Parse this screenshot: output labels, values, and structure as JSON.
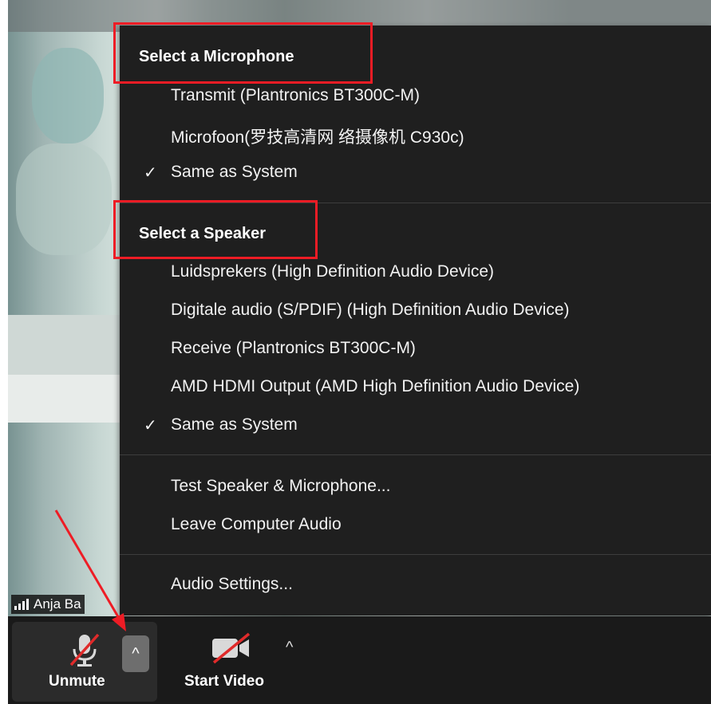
{
  "participant": {
    "name": "Anja Ba",
    "signal_icon": "signal-bars-icon"
  },
  "menu": {
    "microphone_heading": "Select a Microphone",
    "microphones": [
      {
        "label": "Transmit (Plantronics BT300C-M)",
        "checked": false
      },
      {
        "label": "Microfoon(罗技高清网 络摄像机 C930c)",
        "checked": false
      },
      {
        "label": "Same as System",
        "checked": true
      }
    ],
    "speaker_heading": "Select a Speaker",
    "speakers": [
      {
        "label": "Luidsprekers (High Definition Audio Device)",
        "checked": false
      },
      {
        "label": "Digitale audio (S/PDIF) (High Definition Audio Device)",
        "checked": false
      },
      {
        "label": "Receive (Plantronics BT300C-M)",
        "checked": false
      },
      {
        "label": "AMD HDMI Output (AMD High Definition Audio Device)",
        "checked": false
      },
      {
        "label": "Same as System",
        "checked": true
      }
    ],
    "test_label": "Test Speaker & Microphone...",
    "leave_label": "Leave Computer Audio",
    "settings_label": "Audio Settings...",
    "check_glyph": "✓"
  },
  "toolbar": {
    "unmute_label": "Unmute",
    "start_video_label": "Start Video",
    "caret_glyph": "^"
  },
  "colors": {
    "highlight": "#ee1c25",
    "menu_bg": "#1f1f1f",
    "toolbar_bg": "#1a1a1a"
  }
}
